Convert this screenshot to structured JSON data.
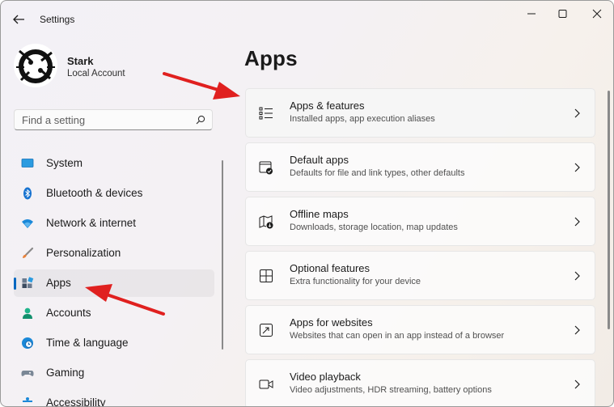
{
  "window": {
    "title": "Settings"
  },
  "account": {
    "name": "Stark",
    "type": "Local Account"
  },
  "search": {
    "placeholder": "Find a setting"
  },
  "sidebar": {
    "items": [
      {
        "label": "System",
        "icon": "monitor-icon"
      },
      {
        "label": "Bluetooth & devices",
        "icon": "bluetooth-icon"
      },
      {
        "label": "Network & internet",
        "icon": "wifi-icon"
      },
      {
        "label": "Personalization",
        "icon": "brush-icon"
      },
      {
        "label": "Apps",
        "icon": "apps-icon",
        "active": true
      },
      {
        "label": "Accounts",
        "icon": "person-icon"
      },
      {
        "label": "Time & language",
        "icon": "globe-clock-icon"
      },
      {
        "label": "Gaming",
        "icon": "gamepad-icon"
      },
      {
        "label": "Accessibility",
        "icon": "accessibility-icon"
      }
    ]
  },
  "main": {
    "title": "Apps",
    "cards": [
      {
        "title": "Apps & features",
        "subtitle": "Installed apps, app execution aliases",
        "icon": "list-icon"
      },
      {
        "title": "Default apps",
        "subtitle": "Defaults for file and link types, other defaults",
        "icon": "default-apps-icon"
      },
      {
        "title": "Offline maps",
        "subtitle": "Downloads, storage location, map updates",
        "icon": "map-download-icon"
      },
      {
        "title": "Optional features",
        "subtitle": "Extra functionality for your device",
        "icon": "add-grid-icon"
      },
      {
        "title": "Apps for websites",
        "subtitle": "Websites that can open in an app instead of a browser",
        "icon": "open-external-icon"
      },
      {
        "title": "Video playback",
        "subtitle": "Video adjustments, HDR streaming, battery options",
        "icon": "video-icon"
      }
    ]
  },
  "colors": {
    "accent": "#0067c0",
    "annotation": "#e0201f"
  }
}
